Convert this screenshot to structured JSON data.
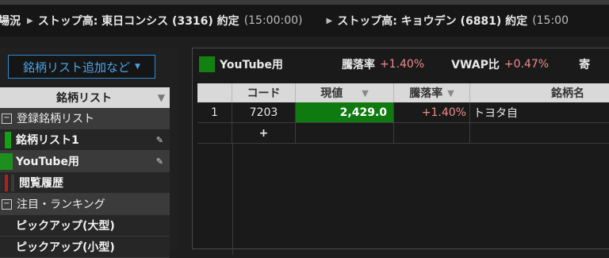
{
  "ticker": {
    "lead": "場況",
    "items": [
      {
        "text": "ストップ高: 東日コンシス (3316)  約定",
        "time": "(15:00:00)"
      },
      {
        "text": "ストップ高: キョウデン (6881)  約定",
        "time": "(15:00"
      }
    ]
  },
  "left": {
    "add_button": "銘柄リスト追加など",
    "header": "銘柄リスト",
    "rows": [
      {
        "kind": "group",
        "label": "登録銘柄リスト",
        "toggle": "−"
      },
      {
        "kind": "item",
        "label": "銘柄リスト1",
        "color": "#14a014",
        "edit": true
      },
      {
        "kind": "item",
        "label": "YouTube用",
        "color": "#1e8f1e",
        "edit": true
      },
      {
        "kind": "item",
        "label": "閲覧履歴",
        "color": "#b02020"
      },
      {
        "kind": "group",
        "label": "注目・ランキング",
        "toggle": "−"
      },
      {
        "kind": "plain",
        "label": "ピックアップ(大型)"
      },
      {
        "kind": "plain",
        "label": "ピックアップ(小型)"
      }
    ]
  },
  "panel": {
    "list_name": "YouTube用",
    "list_color": "#11820f",
    "stats": [
      {
        "label": "騰落率",
        "value": "+1.40%"
      },
      {
        "label": "VWAP比",
        "value": "+0.47%"
      },
      {
        "label": "寄",
        "value": ""
      }
    ]
  },
  "grid": {
    "columns": [
      "",
      "コード",
      "現値",
      "騰落率",
      "銘柄名"
    ],
    "rows": [
      {
        "index": "1",
        "code": "7203",
        "price": "2,429.0",
        "change": "+1.40%",
        "name": "トヨタ自"
      }
    ],
    "add_row": "+"
  }
}
